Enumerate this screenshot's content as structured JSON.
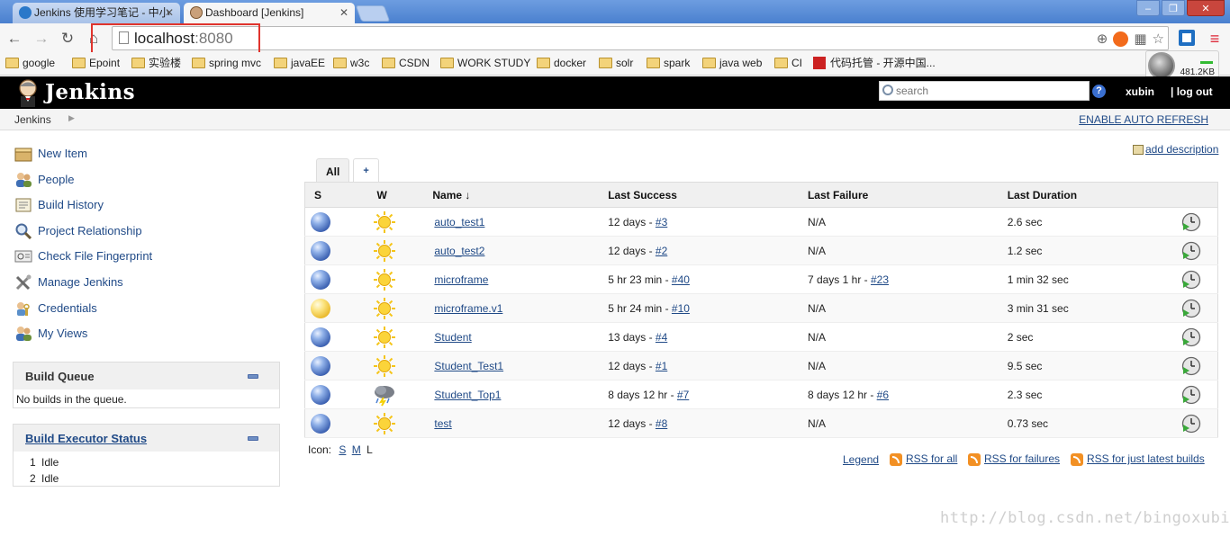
{
  "browser": {
    "tabs": [
      {
        "title": "Jenkins 使用学习笔记 - 中小",
        "close": "✕"
      },
      {
        "title": "Dashboard [Jenkins]",
        "close": "✕"
      }
    ],
    "window_buttons": [
      "–",
      "❐",
      "✕"
    ],
    "url_host": "localhost",
    "url_port": ":8080",
    "bookmarks": [
      "google",
      "Epoint",
      "实验楼",
      "spring mvc",
      "javaEE",
      "w3c",
      "CSDN",
      "WORK STUDY",
      "docker",
      "solr",
      "spark",
      "java web",
      "CI",
      "代码托管 - 开源中国..."
    ],
    "net_speed": "481.2KB"
  },
  "header": {
    "title": "Jenkins",
    "search_placeholder": "search",
    "help": "?",
    "user": "xubin",
    "logout": "| log out"
  },
  "breadcrumb": {
    "root": "Jenkins",
    "auto_refresh": "ENABLE AUTO REFRESH"
  },
  "sidebar": {
    "tasks": [
      {
        "label": "New Item",
        "icon": "new-item-icon"
      },
      {
        "label": "People",
        "icon": "people-icon"
      },
      {
        "label": "Build History",
        "icon": "build-history-icon"
      },
      {
        "label": "Project Relationship",
        "icon": "search-icon"
      },
      {
        "label": "Check File Fingerprint",
        "icon": "fingerprint-icon"
      },
      {
        "label": "Manage Jenkins",
        "icon": "wrench-icon"
      },
      {
        "label": "Credentials",
        "icon": "credentials-icon"
      },
      {
        "label": "My Views",
        "icon": "people-icon"
      }
    ],
    "build_queue": {
      "title": "Build Queue",
      "empty": "No builds in the queue."
    },
    "executors": {
      "title": "Build Executor Status",
      "rows": [
        {
          "num": "1",
          "status": "Idle"
        },
        {
          "num": "2",
          "status": "Idle"
        }
      ]
    }
  },
  "main": {
    "add_description": "add description",
    "view_tabs": [
      "All",
      "+"
    ],
    "columns": [
      "S",
      "W",
      "Name",
      "↓",
      "Last Success",
      "Last Failure",
      "Last Duration"
    ],
    "jobs": [
      {
        "status": "blue",
        "weather": "sunny",
        "name": "auto_test1",
        "success_ago": "12 days - ",
        "success_build": "#3",
        "failure_ago": "N/A",
        "failure_build": "",
        "duration": "2.6 sec"
      },
      {
        "status": "blue",
        "weather": "sunny",
        "name": "auto_test2",
        "success_ago": "12 days - ",
        "success_build": "#2",
        "failure_ago": "N/A",
        "failure_build": "",
        "duration": "1.2 sec"
      },
      {
        "status": "blue",
        "weather": "sunny",
        "name": "microframe",
        "success_ago": "5 hr 23 min - ",
        "success_build": "#40",
        "failure_ago": "7 days 1 hr - ",
        "failure_build": "#23",
        "duration": "1 min 32 sec"
      },
      {
        "status": "yellow",
        "weather": "sunny",
        "name": "microframe.v1",
        "success_ago": "5 hr 24 min - ",
        "success_build": "#10",
        "failure_ago": "N/A",
        "failure_build": "",
        "duration": "3 min 31 sec"
      },
      {
        "status": "blue",
        "weather": "sunny",
        "name": "Student",
        "success_ago": "13 days - ",
        "success_build": "#4",
        "failure_ago": "N/A",
        "failure_build": "",
        "duration": "2 sec"
      },
      {
        "status": "blue",
        "weather": "sunny",
        "name": "Student_Test1",
        "success_ago": "12 days - ",
        "success_build": "#1",
        "failure_ago": "N/A",
        "failure_build": "",
        "duration": "9.5 sec"
      },
      {
        "status": "blue",
        "weather": "storm",
        "name": "Student_Top1",
        "success_ago": "8 days 12 hr - ",
        "success_build": "#7",
        "failure_ago": "8 days 12 hr - ",
        "failure_build": "#6",
        "duration": "2.3 sec"
      },
      {
        "status": "blue",
        "weather": "sunny",
        "name": "test",
        "success_ago": "12 days - ",
        "success_build": "#8",
        "failure_ago": "N/A",
        "failure_build": "",
        "duration": "0.73 sec"
      }
    ],
    "icon_label": "Icon:",
    "icon_sizes": [
      "S",
      "M",
      "L"
    ],
    "legend": "Legend",
    "rss_all": "RSS for all",
    "rss_failures": "RSS for failures",
    "rss_latest": "RSS for just latest builds"
  },
  "watermark": "http://blog.csdn.net/bingoxubin"
}
